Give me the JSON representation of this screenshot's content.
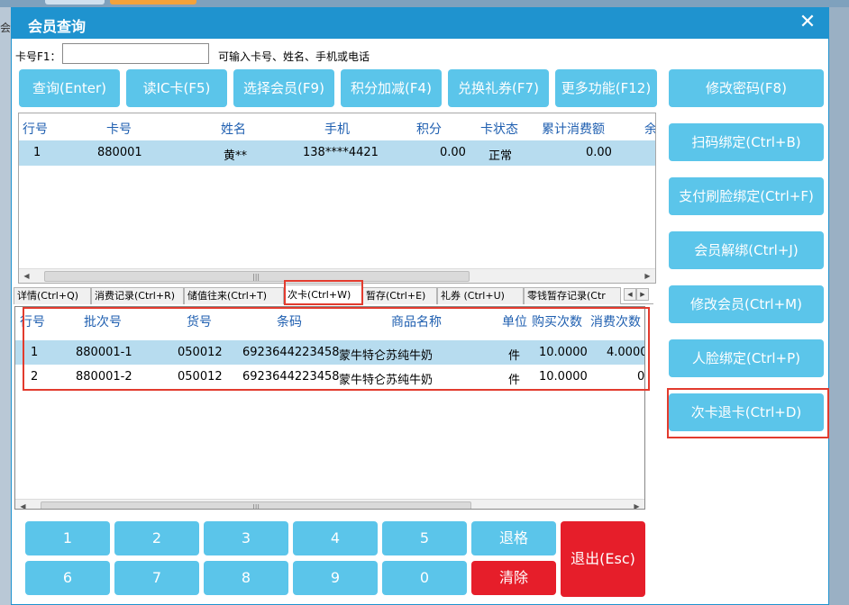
{
  "background": {
    "left_char": "会"
  },
  "window": {
    "title": "会员查询",
    "close_glyph": "✕"
  },
  "search": {
    "label": "卡号F1：",
    "value": "",
    "hint": "可输入卡号、姓名、手机或电话"
  },
  "toolbar": {
    "query": "查询(Enter)",
    "read_ic": "读IC卡(F5)",
    "select_member": "选择会员(F9)",
    "points_adjust": "积分加减(F4)",
    "redeem_coupon": "兑换礼券(F7)",
    "more": "更多功能(F12)"
  },
  "side": {
    "change_password": "修改密码(F8)",
    "scan_bind": "扫码绑定(Ctrl+B)",
    "pay_face_bind": "支付刷脸绑定(Ctrl+F)",
    "unbind": "会员解绑(Ctrl+J)",
    "edit_member": "修改会员(Ctrl+M)",
    "face_bind": "人脸绑定(Ctrl+P)",
    "refund_card": "次卡退卡(Ctrl+D)"
  },
  "member_table": {
    "headers": [
      "行号",
      "卡号",
      "姓名",
      "手机",
      "积分",
      "卡状态",
      "累计消费额",
      "余"
    ],
    "rows": [
      {
        "row_no": "1",
        "card_no": "880001",
        "name": "黄**",
        "phone": "138****4421",
        "points": "0.00",
        "status": "正常",
        "total": "0.00"
      }
    ],
    "grip": "|||"
  },
  "tabs": [
    {
      "label": "详情(Ctrl+Q)",
      "active": false
    },
    {
      "label": "消费记录(Ctrl+R)",
      "active": false
    },
    {
      "label": "储值往来(Ctrl+T)",
      "active": false
    },
    {
      "label": "次卡(Ctrl+W)",
      "active": true
    },
    {
      "label": "暂存(Ctrl+E)",
      "active": false
    },
    {
      "label": "礼券 (Ctrl+U)",
      "active": false
    },
    {
      "label": "零钱暂存记录(Ctr",
      "active": false
    }
  ],
  "count_card_table": {
    "headers": [
      "行号",
      "批次号",
      "货号",
      "条码",
      "商品名称",
      "单位",
      "购买次数",
      "消费次数"
    ],
    "rows": [
      {
        "row_no": "1",
        "batch": "880001-1",
        "item_no": "050012",
        "barcode": "6923644223458",
        "product": "蒙牛特仑苏纯牛奶",
        "unit": "件",
        "bought": "10.0000",
        "used": "4.0000"
      },
      {
        "row_no": "2",
        "batch": "880001-2",
        "item_no": "050012",
        "barcode": "6923644223458",
        "product": "蒙牛特仑苏纯牛奶",
        "unit": "件",
        "bought": "10.0000",
        "used": "0"
      }
    ],
    "grip": "|||"
  },
  "keypad": {
    "digits": [
      "1",
      "2",
      "3",
      "4",
      "5",
      "6",
      "7",
      "8",
      "9",
      "0"
    ],
    "backspace": "退格",
    "clear": "清除",
    "exit": "退出(Esc)"
  },
  "colors": {
    "title_bar": "#1f93cf",
    "button": "#5bc5ea",
    "danger": "#e61e2a",
    "selection": "#b7dcef",
    "header_text": "#1f5fb0",
    "highlight_box": "#e23b2e"
  }
}
